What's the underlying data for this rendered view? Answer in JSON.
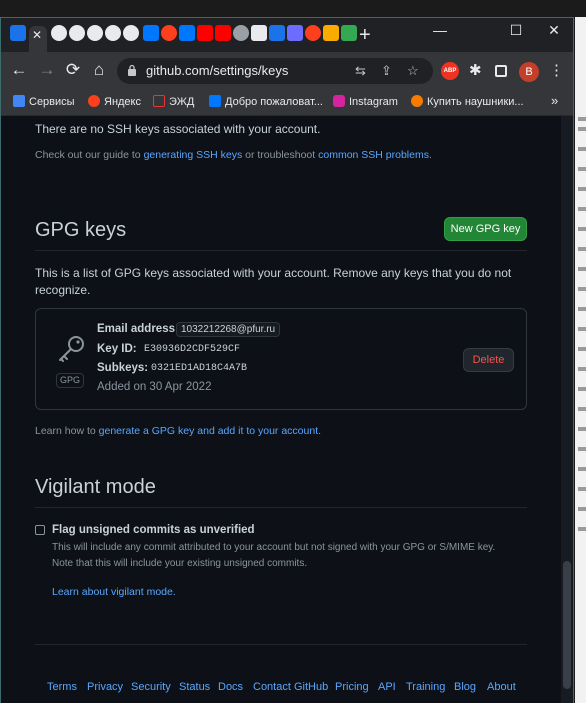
{
  "browser": {
    "url": "github.com/settings/keys",
    "avatar_letter": "B",
    "abp_label": "ABP",
    "new_tab": "+",
    "minimize": "—",
    "maximize": "☐",
    "close": "✕",
    "back": "←",
    "forward": "→",
    "reload": "⟳",
    "home": "⌂"
  },
  "bookmarks": [
    {
      "label": "Сервисы",
      "icon": "apps-grid-icon"
    },
    {
      "label": "Яндекс",
      "icon": "yandex-icon"
    },
    {
      "label": "ЭЖД",
      "icon": "document-icon"
    },
    {
      "label": "Добро пожаловат...",
      "icon": "vk-icon"
    },
    {
      "label": "Instagram",
      "icon": "instagram-icon"
    },
    {
      "label": "Купить наушники...",
      "icon": "shop-icon"
    }
  ],
  "bookmarks_overflow": "»",
  "ssh": {
    "empty_text": "There are no SSH keys associated with your account.",
    "guide_prefix": "Check out our guide to",
    "guide_link1": "generating SSH keys",
    "guide_middle": "or troubleshoot",
    "guide_link2": "common SSH problems",
    "guide_end": "."
  },
  "gpg": {
    "title": "GPG keys",
    "new_button": "New GPG key",
    "description_line1": "This is a list of GPG keys associated with your account. Remove any keys that you do not",
    "description_line2": "recognize.",
    "key": {
      "badge": "GPG",
      "email_label": "Email address:",
      "email_value": "1032212268@pfur.ru",
      "keyid_label": "Key ID:",
      "keyid_value": "E30936D2CDF529CF",
      "subkeys_label": "Subkeys:",
      "subkeys_value": "0321ED1AD18C4A7B",
      "added": "Added on 30 Apr 2022",
      "delete_button": "Delete"
    },
    "learn_prefix": "Learn how to",
    "learn_link": "generate a GPG key and add it to your account",
    "learn_end": "."
  },
  "vigilant": {
    "title": "Vigilant mode",
    "checkbox_label": "Flag unsigned commits as unverified",
    "checked": false,
    "help_line1": "This will include any commit attributed to your account but not signed with your GPG or S/MIME key.",
    "help_line2": "Note that this will include your existing unsigned commits.",
    "learn_link": "Learn about vigilant mode."
  },
  "footer": [
    "Terms",
    "Privacy",
    "Security",
    "Status",
    "Docs",
    "Contact GitHub",
    "Pricing",
    "API",
    "Training",
    "Blog",
    "About"
  ],
  "colors": {
    "background": "#0d1117",
    "text": "#c9d1d9",
    "muted": "#8b949e",
    "link": "#58a6ff",
    "primary_button": "#238636",
    "danger": "#f85149"
  }
}
